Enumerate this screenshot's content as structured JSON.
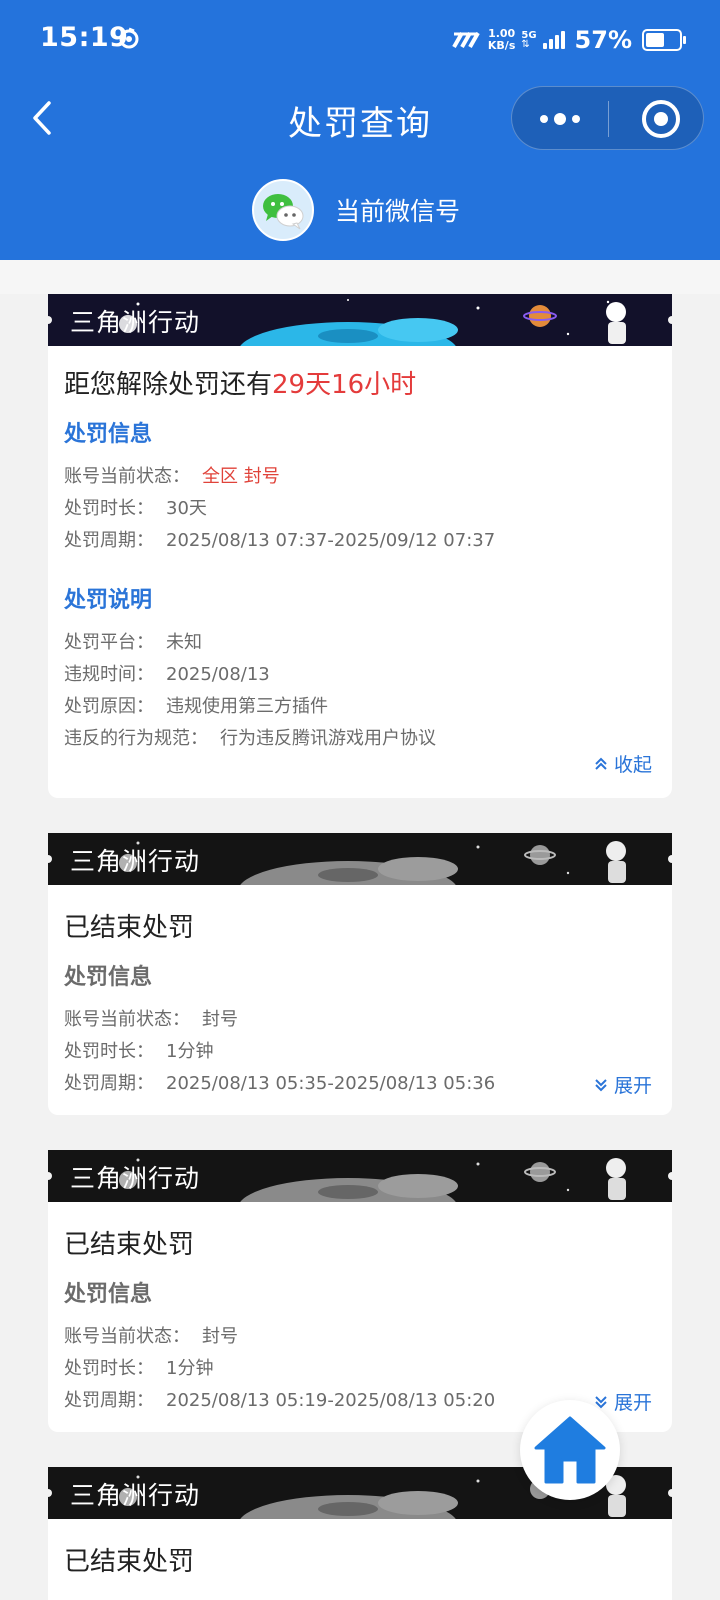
{
  "status_bar": {
    "time": "15:19",
    "net_speed_value": "1.00",
    "net_speed_unit": "KB/s",
    "network": "5G",
    "battery": "57%",
    "battery_level": 0.57
  },
  "nav": {
    "title": "处罚查询",
    "icons": [
      "back-chevron-icon",
      "more-dots-icon",
      "close-target-icon"
    ]
  },
  "account": {
    "label": "当前微信号",
    "avatar_icon": "wechat-logo-icon"
  },
  "colors": {
    "primary": "#2473dc",
    "accent_blue": "#2a74d8",
    "highlight_red": "#e43b3b",
    "muted_text": "#6b6b6b"
  },
  "records": [
    {
      "game": "三角洲行动",
      "headline_prefix": "距您解除处罚还有",
      "headline_highlight": "29天16小时",
      "info_title": "处罚信息",
      "status_label": "账号当前状态：",
      "status_value": "全区 封号",
      "duration_label": "处罚时长：",
      "duration_value": "30天",
      "period_label": "处罚周期：",
      "period_value": "2025/08/13 07:37-2025/09/12 07:37",
      "desc_title": "处罚说明",
      "platform_label": "处罚平台：",
      "platform_value": "未知",
      "violation_time_label": "违规时间：",
      "violation_time_value": "2025/08/13",
      "reason_label": "处罚原因：",
      "reason_value": "违规使用第三方插件",
      "rule_label": "违反的行为规范：",
      "rule_value": "行为违反腾讯游戏用户协议",
      "toggle": "收起"
    },
    {
      "game": "三角洲行动",
      "headline": "已结束处罚",
      "info_title": "处罚信息",
      "status_label": "账号当前状态：",
      "status_value": "封号",
      "duration_label": "处罚时长：",
      "duration_value": "1分钟",
      "period_label": "处罚周期：",
      "period_value": "2025/08/13 05:35-2025/08/13 05:36",
      "toggle": "展开"
    },
    {
      "game": "三角洲行动",
      "headline": "已结束处罚",
      "info_title": "处罚信息",
      "status_label": "账号当前状态：",
      "status_value": "封号",
      "duration_label": "处罚时长：",
      "duration_value": "1分钟",
      "period_label": "处罚周期：",
      "period_value": "2025/08/13 05:19-2025/08/13 05:20",
      "toggle": "展开"
    },
    {
      "game": "三角洲行动",
      "headline": "已结束处罚"
    }
  ],
  "fab": {
    "icon": "home-icon"
  }
}
